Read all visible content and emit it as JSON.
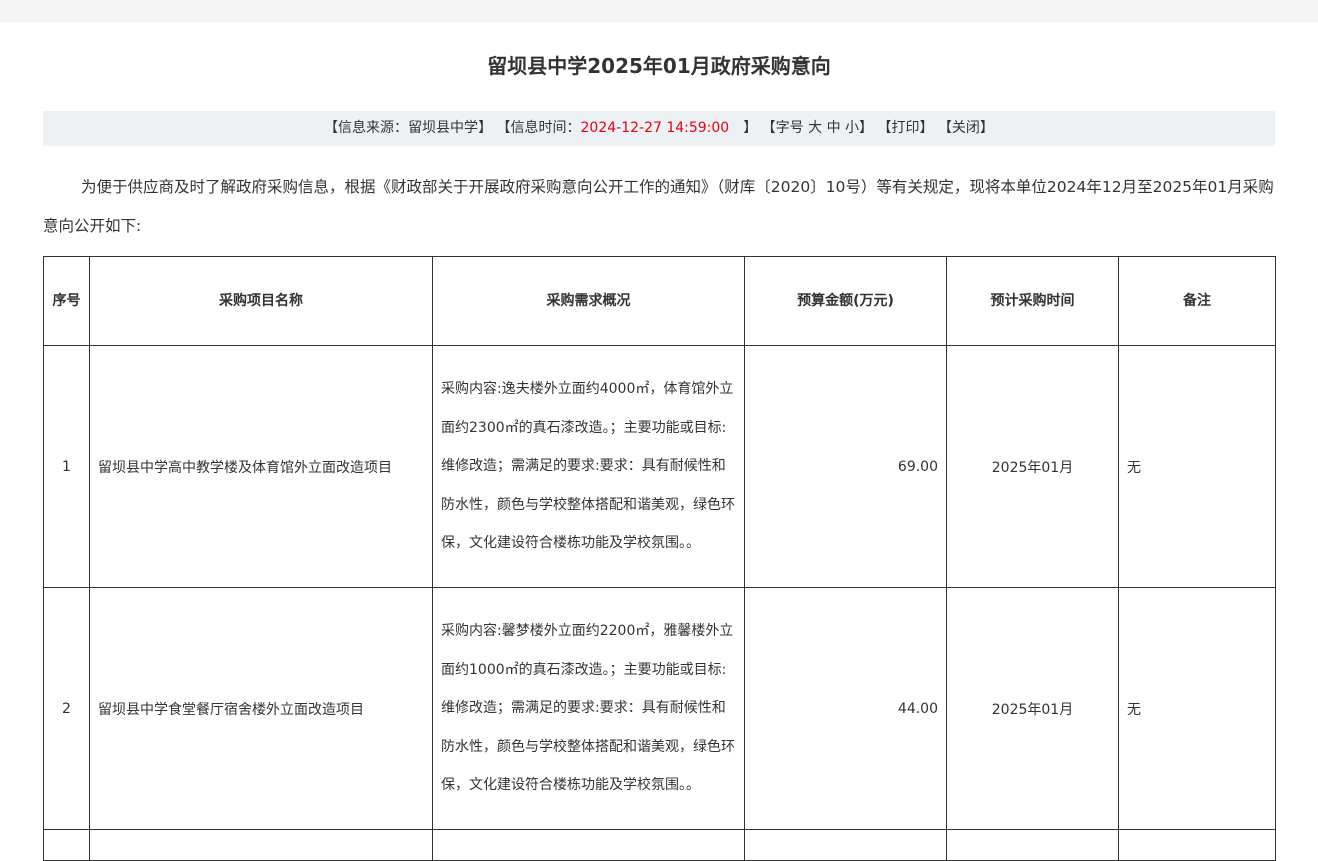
{
  "header": {
    "title": "留坝县中学2025年01月政府采购意向"
  },
  "info": {
    "source_prefix": "【信息来源：",
    "source": "留坝县中学",
    "source_suffix": "】",
    "time_prefix": "【信息时间：",
    "time": "2024-12-27 14:59:00",
    "time_suffix": "　】",
    "font_open": "【字号",
    "font_large": "大",
    "font_medium": "中",
    "font_small": "小",
    "font_close": "】",
    "print": "【打印】",
    "close": "【关闭】"
  },
  "intro": {
    "text": "为便于供应商及时了解政府采购信息，根据《财政部关于开展政府采购意向公开工作的通知》（财库〔2020〕10号）等有关规定，现将本单位2024年12月至2025年01月采购意向公开如下:"
  },
  "table": {
    "headers": {
      "idx": "序号",
      "name": "采购项目名称",
      "desc": "采购需求概况",
      "budget": "预算金额(万元)",
      "time": "预计采购时间",
      "note": "备注"
    },
    "rows": [
      {
        "idx": "1",
        "name": "留坝县中学高中教学楼及体育馆外立面改造项目",
        "desc": "采购内容:逸夫楼外立面约4000㎡，体育馆外立面约2300㎡的真石漆改造。；主要功能或目标:维修改造；需满足的要求:要求：具有耐候性和防水性，颜色与学校整体搭配和谐美观，绿色环保，文化建设符合楼栋功能及学校氛围。。",
        "budget": "69.00",
        "time": "2025年01月",
        "note": "无"
      },
      {
        "idx": "2",
        "name": "留坝县中学食堂餐厅宿舍楼外立面改造项目",
        "desc": "采购内容:馨梦楼外立面约2200㎡，雅馨楼外立面约1000㎡的真石漆改造。；主要功能或目标:维修改造；需满足的要求:要求：具有耐候性和防水性，颜色与学校整体搭配和谐美观，绿色环保，文化建设符合楼栋功能及学校氛围。。",
        "budget": "44.00",
        "time": "2025年01月",
        "note": "无"
      }
    ]
  }
}
